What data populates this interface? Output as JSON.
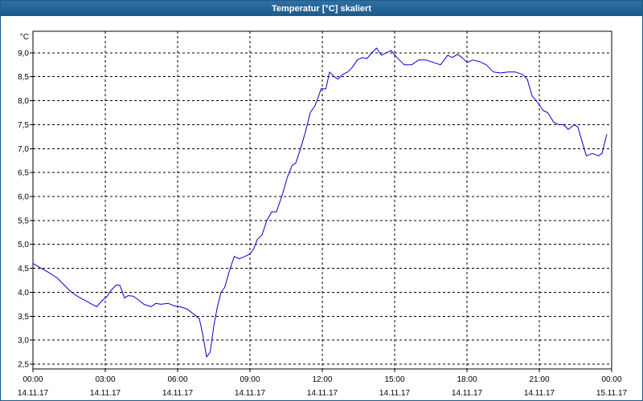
{
  "window": {
    "title": "Temperatur [°C] skaliert"
  },
  "chart_data": {
    "type": "line",
    "title": "Temperatur [°C] skaliert",
    "ylabel": "°C",
    "xlabel": "",
    "grid": true,
    "ylim": [
      2.4,
      9.45
    ],
    "xlim": [
      0,
      24
    ],
    "y_ticks": [
      "9,0",
      "8,5",
      "8,0",
      "7,5",
      "7,0",
      "6,5",
      "6,0",
      "5,5",
      "5,0",
      "4,5",
      "4,0",
      "3,5",
      "3,0",
      "2,5"
    ],
    "y_tick_values": [
      9.0,
      8.5,
      8.0,
      7.5,
      7.0,
      6.5,
      6.0,
      5.5,
      5.0,
      4.5,
      4.0,
      3.5,
      3.0,
      2.5
    ],
    "x_tick_values": [
      0,
      3,
      6,
      9,
      12,
      15,
      18,
      21,
      24
    ],
    "x_tick_times": [
      "00:00",
      "03:00",
      "06:00",
      "09:00",
      "12:00",
      "15:00",
      "18:00",
      "21:00",
      "00:00"
    ],
    "x_tick_dates": [
      "14.11.17",
      "14.11.17",
      "14.11.17",
      "14.11.17",
      "14.11.17",
      "14.11.17",
      "14.11.17",
      "14.11.17",
      "15.11.17"
    ],
    "colors": {
      "series": "#0000cc",
      "grid": "#000000",
      "title_bar": "#1d5a8a"
    },
    "series": [
      {
        "x": [
          0,
          0.35,
          0.7,
          1.0,
          1.3,
          1.6,
          1.9,
          2.2,
          2.45,
          2.65,
          2.85,
          3.05,
          3.25,
          3.45,
          3.6,
          3.8,
          3.95,
          4.15,
          4.35,
          4.6,
          4.9,
          5.1,
          5.3,
          5.6,
          5.85,
          6.1,
          6.4,
          6.65,
          6.9,
          7.05,
          7.2,
          7.35,
          7.5,
          7.65,
          7.8,
          7.95,
          8.15,
          8.35,
          8.55,
          8.8,
          9.0,
          9.15,
          9.3,
          9.5,
          9.7,
          9.9,
          10.1,
          10.35,
          10.55,
          10.75,
          10.9,
          11.1,
          11.3,
          11.5,
          11.7,
          11.85,
          11.95,
          12.15,
          12.3,
          12.5,
          12.65,
          12.85,
          13.05,
          13.25,
          13.45,
          13.65,
          13.85,
          14.05,
          14.25,
          14.45,
          14.65,
          14.85,
          15.1,
          15.4,
          15.7,
          16.0,
          16.3,
          16.6,
          16.9,
          17.2,
          17.4,
          17.6,
          17.8,
          18.0,
          18.25,
          18.5,
          18.8,
          19.1,
          19.4,
          19.7,
          20.0,
          20.3,
          20.5,
          20.7,
          20.95,
          21.15,
          21.35,
          21.6,
          21.8,
          22.0,
          22.2,
          22.45,
          22.6,
          22.8,
          22.95,
          23.2,
          23.45,
          23.6,
          23.8
        ],
        "y": [
          4.6,
          4.5,
          4.4,
          4.3,
          4.15,
          4.0,
          3.9,
          3.82,
          3.75,
          3.7,
          3.82,
          3.9,
          4.05,
          4.15,
          4.15,
          3.88,
          3.93,
          3.92,
          3.85,
          3.75,
          3.7,
          3.77,
          3.75,
          3.77,
          3.72,
          3.7,
          3.65,
          3.55,
          3.45,
          3.1,
          2.65,
          2.75,
          3.3,
          3.7,
          4.0,
          4.1,
          4.45,
          4.75,
          4.7,
          4.75,
          4.8,
          4.9,
          5.1,
          5.2,
          5.5,
          5.68,
          5.68,
          6.05,
          6.4,
          6.65,
          6.7,
          7.0,
          7.35,
          7.75,
          7.9,
          8.1,
          8.25,
          8.25,
          8.6,
          8.5,
          8.45,
          8.55,
          8.6,
          8.7,
          8.85,
          8.9,
          8.88,
          9.0,
          9.1,
          8.95,
          9.0,
          9.05,
          8.9,
          8.75,
          8.75,
          8.85,
          8.85,
          8.8,
          8.75,
          8.95,
          8.9,
          8.97,
          8.9,
          8.8,
          8.85,
          8.82,
          8.75,
          8.6,
          8.58,
          8.6,
          8.6,
          8.55,
          8.45,
          8.1,
          7.95,
          7.8,
          7.75,
          7.55,
          7.5,
          7.5,
          7.4,
          7.5,
          7.45,
          7.1,
          6.85,
          6.9,
          6.85,
          6.9,
          7.3
        ]
      }
    ]
  }
}
